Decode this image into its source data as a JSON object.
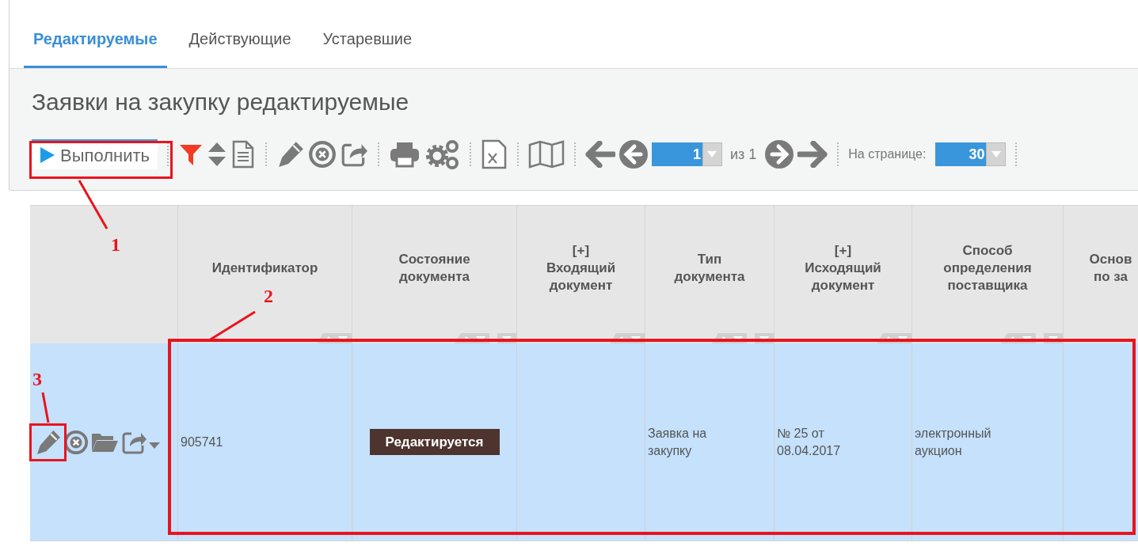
{
  "tabs": [
    {
      "label": "Редактируемые",
      "selected": true
    },
    {
      "label": "Действующие",
      "selected": false
    },
    {
      "label": "Устаревшие",
      "selected": false
    }
  ],
  "title": "Заявки на закупку редактируемые",
  "toolbar": {
    "run_button": "Выполнить",
    "page_field": "1",
    "page_total": "из 1",
    "per_page_label": "На странице:",
    "per_page_field": "30"
  },
  "table": {
    "columns": [
      {
        "label": "Идентификатор",
        "filterable": false
      },
      {
        "label": "Состояние\nдокумента",
        "filterable": true
      },
      {
        "label": "[+]\nВходящий\nдокумент",
        "filterable": false
      },
      {
        "label": "Тип\nдокумента",
        "filterable": true
      },
      {
        "label": "[+]\nИсходящий\nдокумент",
        "filterable": false
      },
      {
        "label": "Способ\nопределения\nпоставщика",
        "filterable": true
      },
      {
        "label": "Основ\nпо за"
      }
    ],
    "rows": [
      {
        "selected": true,
        "cells": [
          {
            "kind": "text",
            "text": "905741"
          },
          {
            "kind": "badge",
            "text": "Редактируется"
          },
          {
            "kind": "empty"
          },
          {
            "kind": "text",
            "text": "Заявка на\nзакупку"
          },
          {
            "kind": "text",
            "text": "№ 25 от\n08.04.2017"
          },
          {
            "kind": "text",
            "text": "электронный\nаукцион"
          },
          {
            "kind": "empty"
          }
        ]
      }
    ]
  },
  "annotations": [
    {
      "label": "1"
    },
    {
      "label": "2"
    },
    {
      "label": "3"
    }
  ]
}
